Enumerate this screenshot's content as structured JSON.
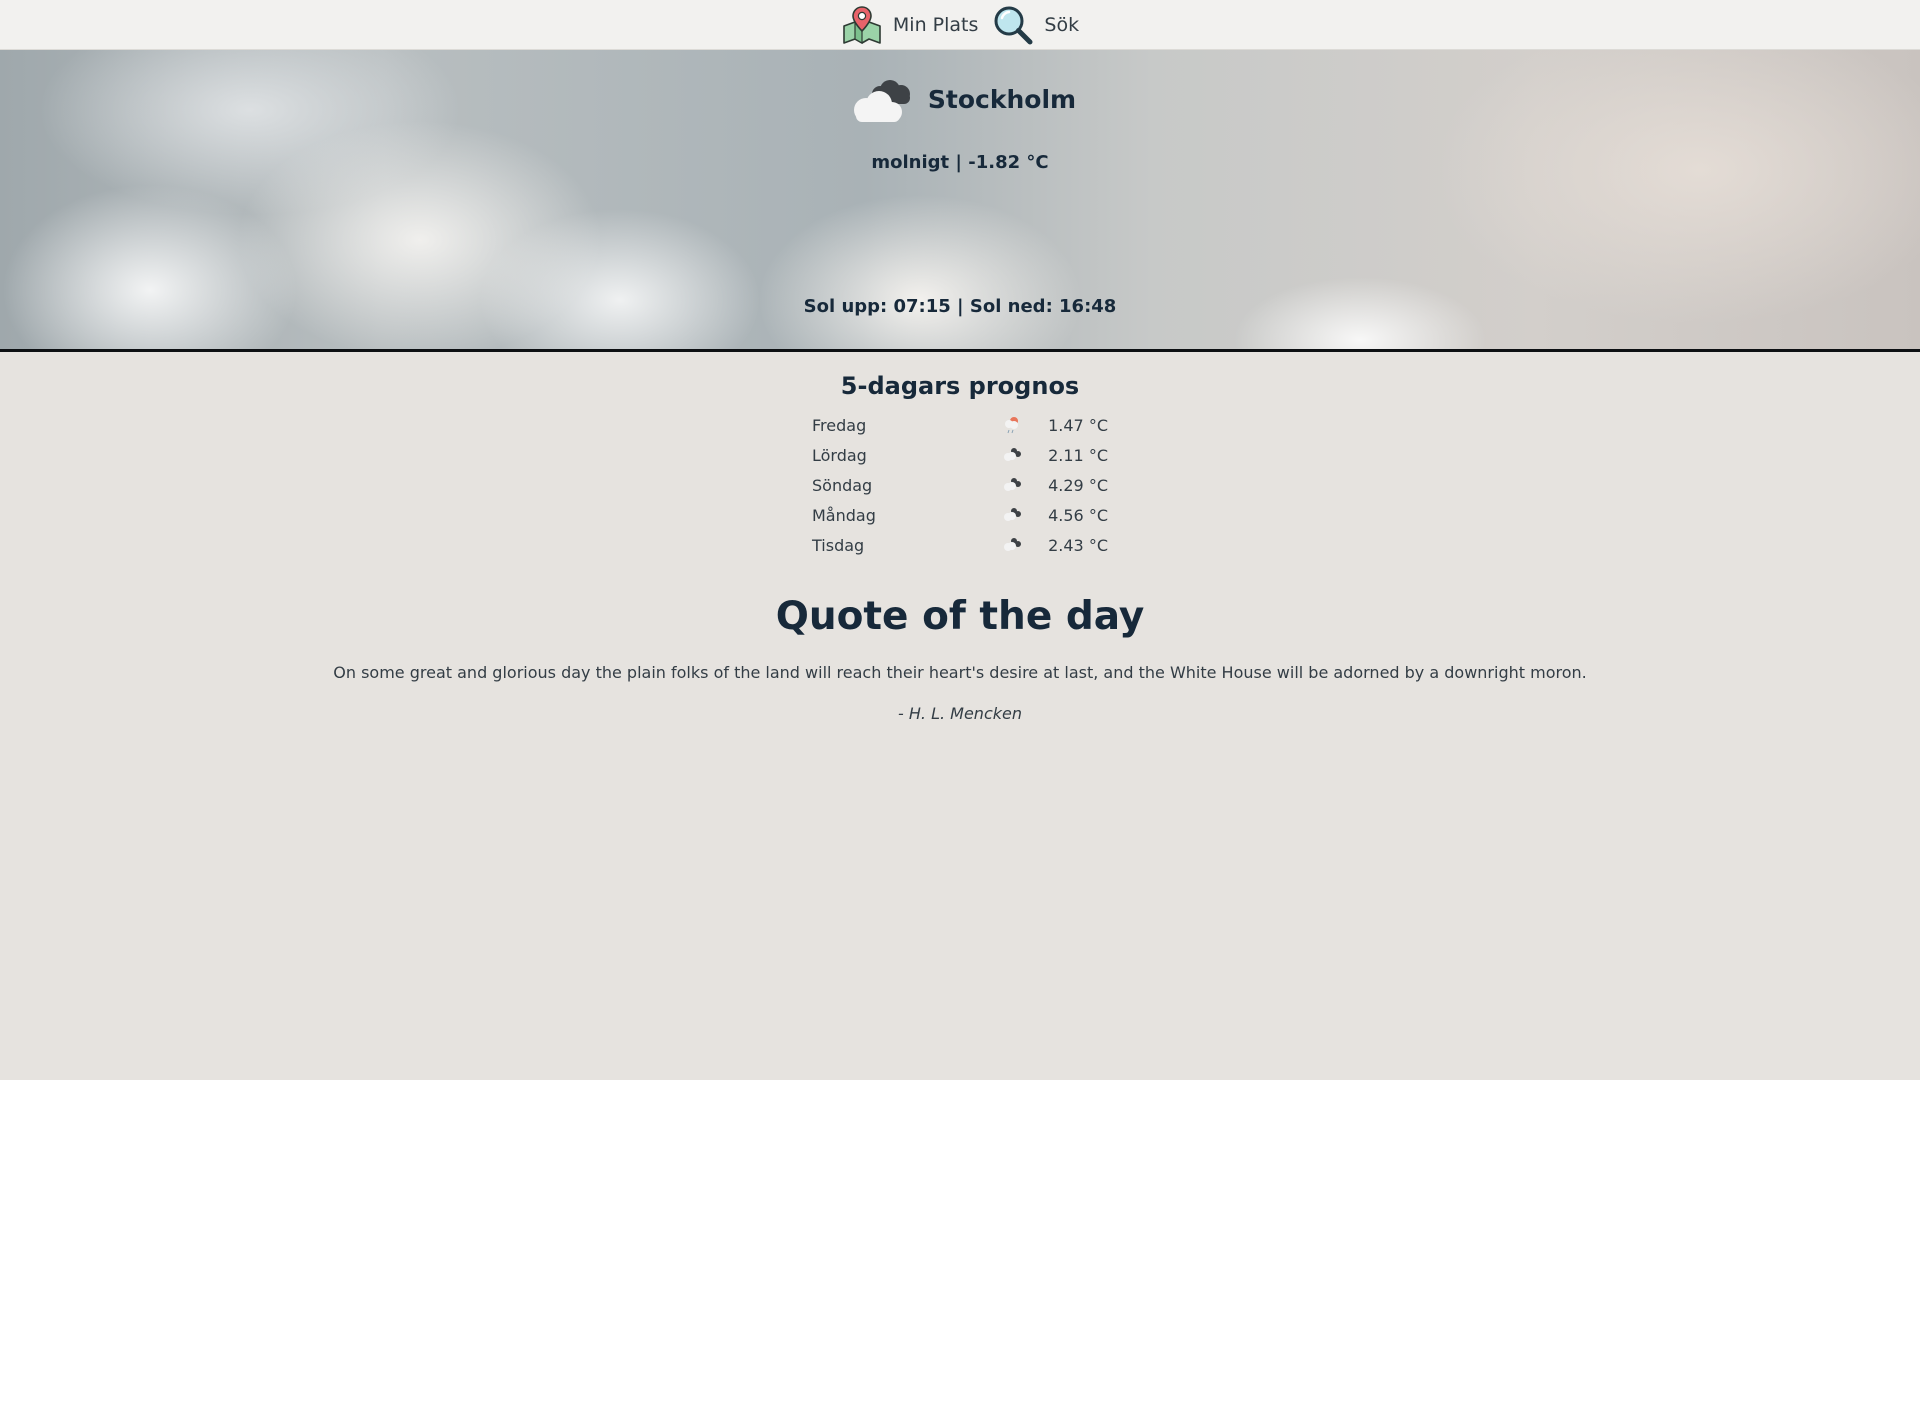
{
  "nav": {
    "location_label": "Min Plats",
    "search_label": "Sök",
    "location_icon": "map-pin-icon",
    "search_icon": "magnifier-icon"
  },
  "current": {
    "city": "Stockholm",
    "conditions": "molnigt | -1.82 °C",
    "sun": "Sol upp: 07:15 |  Sol ned: 16:48",
    "icon": "cloudy-icon"
  },
  "forecast": {
    "title": "5-dagars prognos",
    "days": [
      {
        "day": "Fredag",
        "temp": "1.47 °C",
        "icon": "rain-icon"
      },
      {
        "day": "Lördag",
        "temp": "2.11 °C",
        "icon": "cloudy-icon"
      },
      {
        "day": "Söndag",
        "temp": "4.29 °C",
        "icon": "cloudy-icon"
      },
      {
        "day": "Måndag",
        "temp": "4.56 °C",
        "icon": "cloudy-icon"
      },
      {
        "day": "Tisdag",
        "temp": "2.43 °C",
        "icon": "cloudy-icon"
      }
    ]
  },
  "quote": {
    "title": "Quote of the day",
    "text": "On some great and glorious day the plain folks of the land will reach their heart's desire at last, and the White House will be adorned by a downright moron.",
    "author": "- H. L. Mencken"
  },
  "colors": {
    "text_dark": "#17293a",
    "page_bg": "#e6e3df",
    "nav_bg": "#f2f1ef"
  }
}
